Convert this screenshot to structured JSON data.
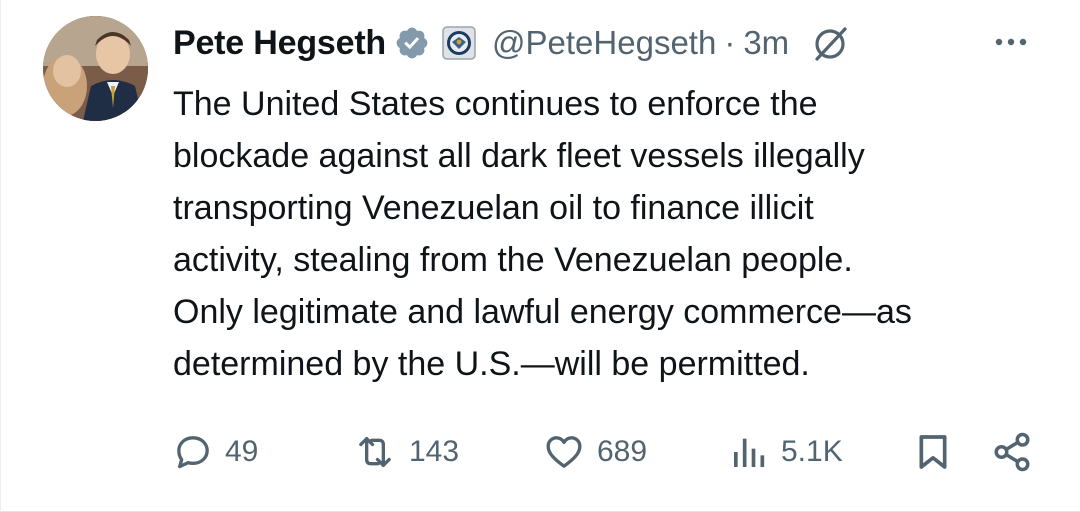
{
  "author": {
    "name": "Pete Hegseth",
    "handle": "@PeteHegseth",
    "separator": "·",
    "time": "3m"
  },
  "icons": {
    "verified": "verified-badge-icon",
    "affiliation": "dod-seal-icon",
    "grok": "grok-icon",
    "more": "more-options-icon"
  },
  "tweet": {
    "text": "The United States continues to enforce the\nblockade against all dark fleet vessels illegally\ntransporting Venezuelan oil to finance illicit\nactivity, stealing from the Venezuelan people.\nOnly legitimate and lawful energy commerce—as\ndetermined by the U.S.—will be permitted."
  },
  "stats": {
    "replies": "49",
    "reposts": "143",
    "likes": "689",
    "views": "5.1K"
  },
  "colors": {
    "text": "#0f1419",
    "secondary": "#536471",
    "verified_badge": "#829aab"
  }
}
